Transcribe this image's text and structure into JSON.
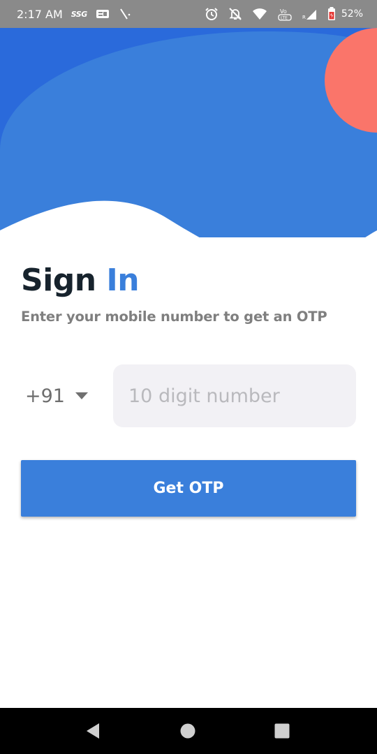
{
  "status_bar": {
    "time": "2:17 AM",
    "carrier": "SSG",
    "battery": "52%",
    "icons": [
      "sim-card-icon",
      "signal-slash-icon",
      "alarm-icon",
      "notifications-off-icon",
      "wifi-icon",
      "volte-icon",
      "cell-signal-icon",
      "battery-charging-icon"
    ]
  },
  "signin": {
    "title_main": "Sign ",
    "title_accent": "In",
    "subtitle": "Enter your mobile number to get an OTP"
  },
  "phone": {
    "country_code": "+91",
    "placeholder": "10 digit number",
    "value": ""
  },
  "otp_button": {
    "label": "Get OTP"
  },
  "nav": [
    "back-icon",
    "home-icon",
    "recents-icon"
  ],
  "colors": {
    "accent": "#3a7fdb",
    "dark_blue": "#2a6adb",
    "coral": "#fa756a",
    "title": "#17232d",
    "input_bg": "#f2f1f5"
  }
}
